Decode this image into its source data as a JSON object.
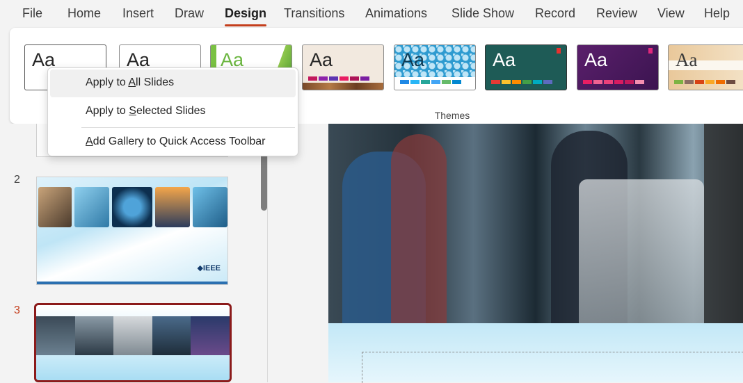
{
  "menu": {
    "tabs": [
      "File",
      "Home",
      "Insert",
      "Draw",
      "Design",
      "Transitions",
      "Animations",
      "Slide Show",
      "Record",
      "Review",
      "View",
      "Help"
    ],
    "active_tab": "Design"
  },
  "ribbon": {
    "group_label": "Themes",
    "theme_preview_text": "Aa"
  },
  "context_menu": {
    "items": [
      {
        "prefix": "Apply to ",
        "accel": "A",
        "suffix": "ll Slides"
      },
      {
        "prefix": "Apply to ",
        "accel": "S",
        "suffix": "elected Slides"
      },
      {
        "prefix": "",
        "accel": "A",
        "suffix": "dd Gallery to Quick Access Toolbar"
      }
    ]
  },
  "slides": {
    "numbers": [
      "2",
      "3"
    ],
    "thumb2_logo": "◆IEEE"
  },
  "colors": {
    "accent": "#c43e1c",
    "selected_slide_border": "#8b1a1a"
  }
}
